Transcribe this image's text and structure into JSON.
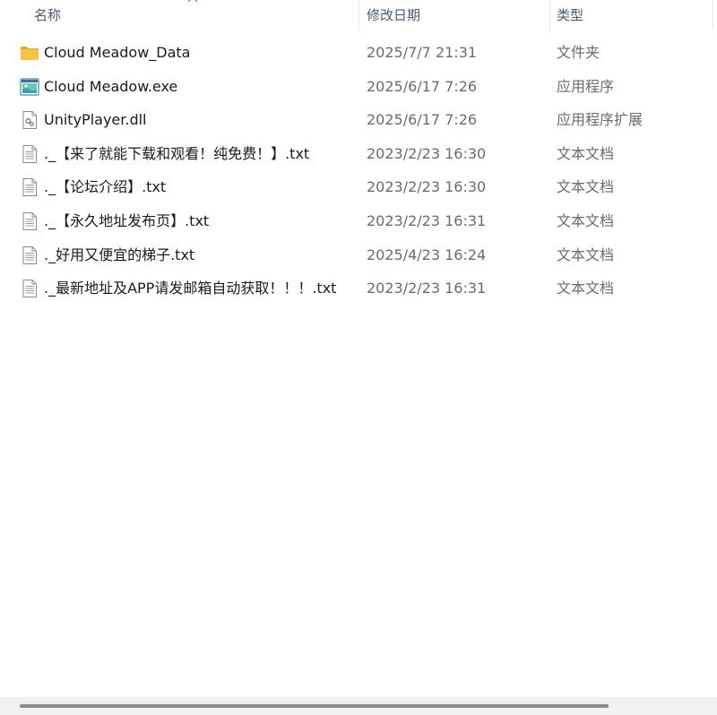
{
  "header": {
    "name_label": "名称",
    "date_label": "修改日期",
    "type_label": "类型",
    "sort_icon": "chevron-up-icon"
  },
  "files": [
    {
      "name": "Cloud Meadow_Data",
      "date": "2025/7/7 21:31",
      "type": "文件夹",
      "icon": "folder-icon"
    },
    {
      "name": "Cloud Meadow.exe",
      "date": "2025/6/17 7:26",
      "type": "应用程序",
      "icon": "app-exe-icon"
    },
    {
      "name": "UnityPlayer.dll",
      "date": "2025/6/17 7:26",
      "type": "应用程序扩展",
      "icon": "dll-file-icon"
    },
    {
      "name": "._【来了就能下载和观看！纯免费！】.txt",
      "date": "2023/2/23 16:30",
      "type": "文本文档",
      "icon": "text-file-icon"
    },
    {
      "name": "._【论坛介绍】.txt",
      "date": "2023/2/23 16:30",
      "type": "文本文档",
      "icon": "text-file-icon"
    },
    {
      "name": "._【永久地址发布页】.txt",
      "date": "2023/2/23 16:31",
      "type": "文本文档",
      "icon": "text-file-icon"
    },
    {
      "name": "._好用又便宜的梯子.txt",
      "date": "2025/4/23 16:24",
      "type": "文本文档",
      "icon": "text-file-icon"
    },
    {
      "name": "._最新地址及APP请发邮箱自动获取！！！.txt",
      "date": "2023/2/23 16:31",
      "type": "文本文档",
      "icon": "text-file-icon"
    }
  ],
  "colors": {
    "folder": "#f5c242",
    "header_text": "#4a5a6e",
    "secondary_text": "#6b6b6b",
    "scroll_thumb": "#8a8a8a"
  }
}
